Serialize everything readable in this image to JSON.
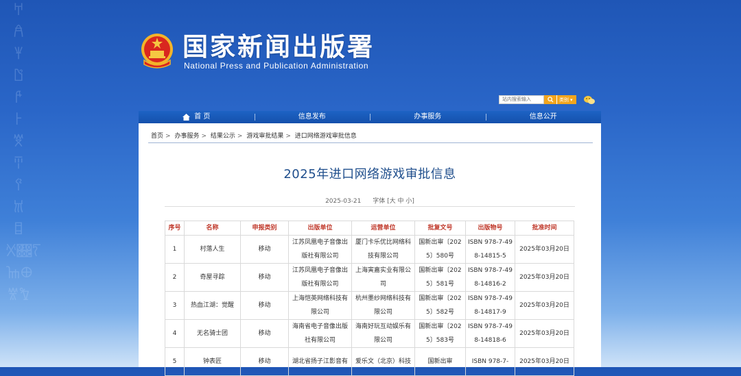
{
  "site": {
    "title_cn": "国家新闻出版署",
    "title_en": "National  Press and Publication Administration"
  },
  "search": {
    "placeholder": "站内搜索输入",
    "category": "类别"
  },
  "nav": [
    {
      "label": "首 页"
    },
    {
      "label": "信息发布"
    },
    {
      "label": "办事服务"
    },
    {
      "label": "信息公开"
    }
  ],
  "breadcrumb": [
    "首页",
    "办事服务",
    "结果公示",
    "游戏审批结果",
    "进口网络游戏审批信息"
  ],
  "article": {
    "title": "2025年进口网络游戏审批信息",
    "date": "2025-03-21",
    "font_label": "字体",
    "font_options": "[大 中 小]"
  },
  "table": {
    "headers": [
      "序号",
      "名称",
      "申报类别",
      "出版单位",
      "运营单位",
      "批复文号",
      "出版物号",
      "批准时间"
    ],
    "rows": [
      [
        "1",
        "村落人生",
        "移动",
        "江苏凤凰电子音像出版社有限公司",
        "厦门卡乐优比网络科技有限公司",
        "国新出审〔2025〕580号",
        "ISBN 978-7-498-14815-5",
        "2025年03月20日"
      ],
      [
        "2",
        "奇屋寻踪",
        "移动",
        "江苏凤凰电子音像出版社有限公司",
        "上海寅嘉实业有限公司",
        "国新出审〔2025〕581号",
        "ISBN 978-7-498-14816-2",
        "2025年03月20日"
      ],
      [
        "3",
        "热血江湖：觉醒",
        "移动",
        "上海恺英网络科技有限公司",
        "杭州墨纱网络科技有限公司",
        "国新出审〔2025〕582号",
        "ISBN 978-7-498-14817-9",
        "2025年03月20日"
      ],
      [
        "4",
        "无名骑士团",
        "移动",
        "海南省电子音像出版社有限公司",
        "海南好玩互动娱乐有限公司",
        "国新出审〔2025〕583号",
        "ISBN 978-7-498-14818-6",
        "2025年03月20日"
      ],
      [
        "5",
        "钟表匠",
        "移动",
        "湖北省扬子江影音有",
        "爱乐文（北京）科技",
        "国新出审",
        "ISBN 978-7-",
        "2025年03月20日"
      ]
    ]
  },
  "colors": {
    "brand_blue": "#1f56b6",
    "title_blue": "#1f4e8c",
    "header_red": "#c0392b",
    "accent_orange": "#f2a51e"
  }
}
